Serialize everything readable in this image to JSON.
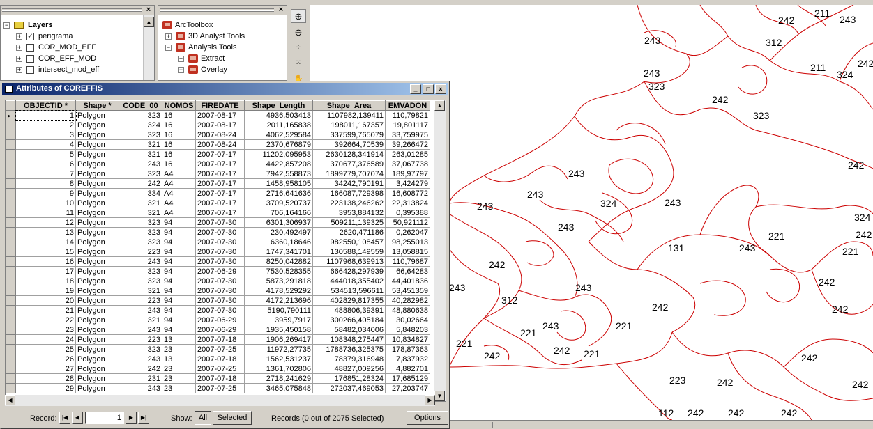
{
  "layers_panel": {
    "title": "Layers",
    "items": [
      {
        "label": "perigrama",
        "checked": true
      },
      {
        "label": "COR_MOD_EFF",
        "checked": false
      },
      {
        "label": "COR_EFF_MOD",
        "checked": false
      },
      {
        "label": "intersect_mod_eff",
        "checked": false
      }
    ]
  },
  "toolbox_panel": {
    "root": "ArcToolbox",
    "items": [
      {
        "label": "3D Analyst Tools",
        "expanded": false
      },
      {
        "label": "Analysis Tools",
        "expanded": true
      },
      {
        "label": "Extract",
        "expanded": false
      },
      {
        "label": "Overlay",
        "expanded": true
      }
    ]
  },
  "map_labels": [
    {
      "text": "242"
    },
    {
      "text": "211"
    },
    {
      "text": "243"
    },
    {
      "text": "243"
    },
    {
      "text": "312"
    },
    {
      "text": "211"
    },
    {
      "text": "324"
    },
    {
      "text": "242"
    },
    {
      "text": "243"
    },
    {
      "text": "323"
    },
    {
      "text": "242"
    },
    {
      "text": "323"
    },
    {
      "text": "242"
    },
    {
      "text": "243"
    },
    {
      "text": "243"
    },
    {
      "text": "243"
    },
    {
      "text": "324"
    },
    {
      "text": "243"
    },
    {
      "text": "243"
    },
    {
      "text": "324"
    },
    {
      "text": "221"
    },
    {
      "text": "242"
    },
    {
      "text": "131"
    },
    {
      "text": "243"
    },
    {
      "text": "221"
    },
    {
      "text": "242"
    },
    {
      "text": "243"
    },
    {
      "text": "243"
    },
    {
      "text": "242"
    },
    {
      "text": "312"
    },
    {
      "text": "242"
    },
    {
      "text": "242"
    },
    {
      "text": "243"
    },
    {
      "text": "221"
    },
    {
      "text": "221"
    },
    {
      "text": "221"
    },
    {
      "text": "242"
    },
    {
      "text": "242"
    },
    {
      "text": "221"
    },
    {
      "text": "242"
    },
    {
      "text": "223"
    },
    {
      "text": "242"
    },
    {
      "text": "242"
    },
    {
      "text": "112"
    },
    {
      "text": "242"
    },
    {
      "text": "242"
    },
    {
      "text": "242"
    }
  ],
  "attributes": {
    "title": "Attributes of COREFFIS",
    "columns": [
      "OBJECTID *",
      "Shape *",
      "CODE_00",
      "NOMOS",
      "FIREDATE",
      "Shape_Length",
      "Shape_Area",
      "EMVADON"
    ],
    "rows": [
      [
        "1",
        "Polygon",
        "323",
        "16",
        "2007-08-17",
        "4936,503413",
        "1107982,139411",
        "110,79821"
      ],
      [
        "2",
        "Polygon",
        "324",
        "16",
        "2007-08-17",
        "2011,165838",
        "198011,167357",
        "19,801117"
      ],
      [
        "3",
        "Polygon",
        "323",
        "16",
        "2007-08-24",
        "4062,529584",
        "337599,765079",
        "33,759975"
      ],
      [
        "4",
        "Polygon",
        "321",
        "16",
        "2007-08-24",
        "2370,676879",
        "392664,70539",
        "39,266472"
      ],
      [
        "5",
        "Polygon",
        "321",
        "16",
        "2007-07-17",
        "11202,095953",
        "2630128,341914",
        "263,01285"
      ],
      [
        "6",
        "Polygon",
        "243",
        "16",
        "2007-07-17",
        "4422,857208",
        "370677,376589",
        "37,067738"
      ],
      [
        "7",
        "Polygon",
        "323",
        "A4",
        "2007-07-17",
        "7942,558873",
        "1899779,707074",
        "189,97797"
      ],
      [
        "8",
        "Polygon",
        "242",
        "A4",
        "2007-07-17",
        "1458,958105",
        "34242,790191",
        "3,424279"
      ],
      [
        "9",
        "Polygon",
        "334",
        "A4",
        "2007-07-17",
        "2716,641636",
        "166087,729398",
        "16,608772"
      ],
      [
        "10",
        "Polygon",
        "321",
        "A4",
        "2007-07-17",
        "3709,520737",
        "223138,246262",
        "22,313824"
      ],
      [
        "11",
        "Polygon",
        "321",
        "A4",
        "2007-07-17",
        "706,164166",
        "3953,884132",
        "0,395388"
      ],
      [
        "12",
        "Polygon",
        "323",
        "94",
        "2007-07-30",
        "6301,306937",
        "509211,139325",
        "50,921112"
      ],
      [
        "13",
        "Polygon",
        "323",
        "94",
        "2007-07-30",
        "230,492497",
        "2620,471186",
        "0,262047"
      ],
      [
        "14",
        "Polygon",
        "323",
        "94",
        "2007-07-30",
        "6360,18646",
        "982550,108457",
        "98,255013"
      ],
      [
        "15",
        "Polygon",
        "223",
        "94",
        "2007-07-30",
        "1747,341701",
        "130588,149559",
        "13,058815"
      ],
      [
        "16",
        "Polygon",
        "243",
        "94",
        "2007-07-30",
        "8250,042882",
        "1107968,639913",
        "110,79687"
      ],
      [
        "17",
        "Polygon",
        "323",
        "94",
        "2007-06-29",
        "7530,528355",
        "666428,297939",
        "66,64283"
      ],
      [
        "18",
        "Polygon",
        "323",
        "94",
        "2007-07-30",
        "5873,291818",
        "444018,355402",
        "44,401836"
      ],
      [
        "19",
        "Polygon",
        "321",
        "94",
        "2007-07-30",
        "4178,529292",
        "534513,596611",
        "53,451359"
      ],
      [
        "20",
        "Polygon",
        "223",
        "94",
        "2007-07-30",
        "4172,213696",
        "402829,817355",
        "40,282982"
      ],
      [
        "21",
        "Polygon",
        "243",
        "94",
        "2007-07-30",
        "5190,790111",
        "488806,39391",
        "48,880638"
      ],
      [
        "22",
        "Polygon",
        "321",
        "94",
        "2007-06-29",
        "3959,7917",
        "300266,405184",
        "30,02664"
      ],
      [
        "23",
        "Polygon",
        "243",
        "94",
        "2007-06-29",
        "1935,450158",
        "58482,034006",
        "5,848203"
      ],
      [
        "24",
        "Polygon",
        "223",
        "13",
        "2007-07-18",
        "1906,269417",
        "108348,275447",
        "10,834827"
      ],
      [
        "25",
        "Polygon",
        "323",
        "23",
        "2007-07-25",
        "11972,27735",
        "1788736,325375",
        "178,87363"
      ],
      [
        "26",
        "Polygon",
        "243",
        "13",
        "2007-07-18",
        "1562,531237",
        "78379,316948",
        "7,837932"
      ],
      [
        "27",
        "Polygon",
        "242",
        "23",
        "2007-07-25",
        "1361,702806",
        "48827,009256",
        "4,882701"
      ],
      [
        "28",
        "Polygon",
        "231",
        "23",
        "2007-07-18",
        "2718,241629",
        "176851,28324",
        "17,685129"
      ],
      [
        "29",
        "Polygon",
        "243",
        "23",
        "2007-07-25",
        "3465,075848",
        "272037,469053",
        "27,203747"
      ]
    ],
    "status": {
      "record_label": "Record:",
      "record_value": "1",
      "show_label": "Show:",
      "all_label": "All",
      "selected_label": "Selected",
      "records_text": "Records (0 out of 2075 Selected)",
      "options_label": "Options"
    }
  }
}
